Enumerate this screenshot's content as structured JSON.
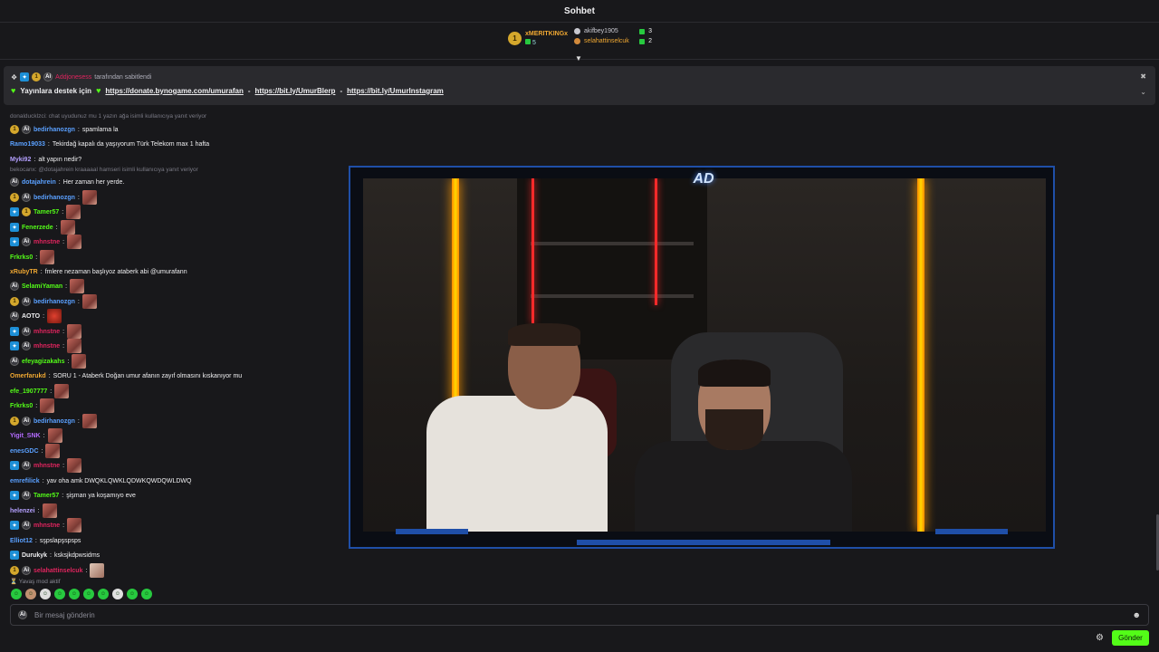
{
  "header": {
    "title": "Sohbet"
  },
  "leaderboard": {
    "top": {
      "name": "xMERITKINGx",
      "rank": "1",
      "count": "5"
    },
    "others": [
      {
        "name": "akifbey1905",
        "count": "3"
      },
      {
        "name": "selahattinselcuk",
        "count": "2"
      }
    ],
    "toggle_icon": "chevron-down-icon"
  },
  "pinned": {
    "by_user": "Addjonesess",
    "by_suffix": "tarafından sabitlendi",
    "message_prefix": "Yayınlara destek için",
    "link1": "https://donate.bynogame.com/umurafan",
    "sep1": "-",
    "link2": "https://bit.ly/UmurBlerp",
    "sep2": "-",
    "link3": "https://bit.ly/UmurInstagram"
  },
  "chat": {
    "messages": [
      {
        "type": "reply",
        "text": "donalducklzci: chat uyudunuz mu 1 yazın ağa isimli kullanıcıya yanıt veriyor"
      },
      {
        "user": "bedirhanozgn",
        "color": "#5aa0ff",
        "badges": [
          "gold",
          "ai"
        ],
        "text": "spamlama la",
        "emote": false
      },
      {
        "user": "Ramo19033",
        "color": "#5aa0ff",
        "badges": [],
        "text": "Tekirdağ kapalı da yaşıyorum Türk Telekom max 1 hafta",
        "emote": false
      },
      {
        "user": "Myki92",
        "color": "#b4a0ff",
        "badges": [],
        "text": "alt yapın nedir?",
        "emote": false
      },
      {
        "type": "reply",
        "text": "bekocanx: @dotajahrein kraaaaal hamseri isimli kullanıcıya yanıt veriyor"
      },
      {
        "user": "dotajahrein",
        "color": "#5aa0ff",
        "badges": [
          "ai"
        ],
        "text": "Her zaman her yerde.",
        "emote": false
      },
      {
        "user": "bedirhanozgn",
        "color": "#5aa0ff",
        "badges": [
          "gold",
          "ai"
        ],
        "text": "",
        "emote": true
      },
      {
        "user": "Tamer57",
        "color": "#53fc18",
        "badges": [
          "blue",
          "gold"
        ],
        "text": "",
        "emote": true
      },
      {
        "user": "Fenerzede",
        "color": "#53fc18",
        "badges": [
          "blue"
        ],
        "text": "",
        "emote": true
      },
      {
        "user": "mhnstne",
        "color": "#e0245e",
        "badges": [
          "blue",
          "ai"
        ],
        "text": "",
        "emote": true
      },
      {
        "user": "Frkrks0",
        "color": "#53fc18",
        "badges": [],
        "text": "",
        "emote": true
      },
      {
        "user": "xRubyTR",
        "color": "#f0a832",
        "badges": [],
        "text": "fmlere nezaman başlıyoz ataberk abi @umurafann",
        "emote": false
      },
      {
        "user": "SelamiYaman",
        "color": "#53fc18",
        "badges": [
          "ai"
        ],
        "text": "",
        "emote": true
      },
      {
        "user": "bedirhanozgn",
        "color": "#5aa0ff",
        "badges": [
          "gold",
          "ai"
        ],
        "text": "",
        "emote": true
      },
      {
        "user": "AOTO",
        "color": "#efeff1",
        "badges": [
          "ai"
        ],
        "text": "",
        "emote": "red"
      },
      {
        "user": "mhnstne",
        "color": "#e0245e",
        "badges": [
          "blue",
          "ai"
        ],
        "text": "",
        "emote": true
      },
      {
        "user": "mhnstne",
        "color": "#e0245e",
        "badges": [
          "blue",
          "ai"
        ],
        "text": "",
        "emote": true
      },
      {
        "user": "efeyagizakahs",
        "color": "#53fc18",
        "badges": [
          "ai"
        ],
        "text": "",
        "emote": true
      },
      {
        "user": "Omerfarukd",
        "color": "#f0a832",
        "badges": [],
        "text": "SORU 1 - Ataberk Doğan umur afanın zayıf olmasını kıskanıyor mu",
        "emote": false
      },
      {
        "user": "efe_1907777",
        "color": "#53fc18",
        "badges": [],
        "text": "",
        "emote": true
      },
      {
        "user": "Frkrks0",
        "color": "#53fc18",
        "badges": [],
        "text": "",
        "emote": true
      },
      {
        "user": "bedirhanozgn",
        "color": "#5aa0ff",
        "badges": [
          "gold",
          "ai"
        ],
        "text": "",
        "emote": true
      },
      {
        "user": "Yigit_SNK",
        "color": "#b46bff",
        "badges": [],
        "text": "",
        "emote": true
      },
      {
        "user": "enesGDC",
        "color": "#5aa0ff",
        "badges": [],
        "text": "",
        "emote": true
      },
      {
        "user": "mhnstne",
        "color": "#e0245e",
        "badges": [
          "blue",
          "ai"
        ],
        "text": "",
        "emote": true
      },
      {
        "user": "emrefilick",
        "color": "#5aa0ff",
        "badges": [],
        "text": "yav oha amk DWQKLQWKLQDWKQWDQWLDWQ",
        "emote": false
      },
      {
        "user": "Tamer57",
        "color": "#53fc18",
        "badges": [
          "blue",
          "ai"
        ],
        "text": "şişman ya koşamıyo eve",
        "emote": false
      },
      {
        "user": "helenzei",
        "color": "#b4a0ff",
        "badges": [],
        "text": "",
        "emote": true
      },
      {
        "user": "mhnstne",
        "color": "#e0245e",
        "badges": [
          "blue",
          "ai"
        ],
        "text": "",
        "emote": true
      },
      {
        "user": "Elliot12",
        "color": "#5aa0ff",
        "badges": [],
        "text": "sşpslapşspsps",
        "emote": false
      },
      {
        "user": "Durukyk",
        "color": "#efeff1",
        "badges": [
          "blue"
        ],
        "text": "ksksjkdpwsidms",
        "emote": false
      },
      {
        "user": "selahattinselcuk",
        "color": "#e0245e",
        "badges": [
          "gold",
          "ai"
        ],
        "text": "",
        "emote": "pale"
      }
    ],
    "slow_mode": "Yavaş mod aktif"
  },
  "input": {
    "placeholder": "Bir mesaj gönderin",
    "send_label": "Gönder"
  },
  "video": {
    "logo_text": "AD"
  },
  "colors": {
    "accent": "#53fc18",
    "frame": "#1f4fa8",
    "bg": "#18181b"
  }
}
